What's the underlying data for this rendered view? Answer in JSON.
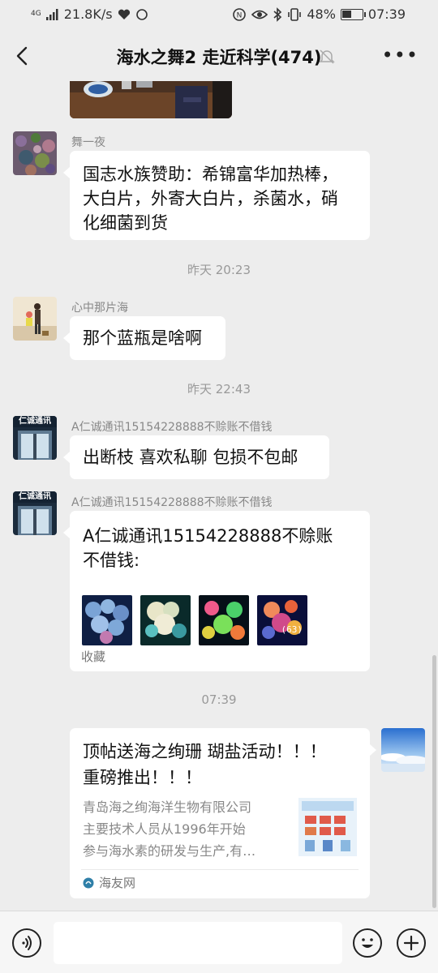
{
  "status": {
    "network": "4G",
    "speed": "21.8K/s",
    "battery": "48%",
    "battery_level": 0.48,
    "time": "07:39"
  },
  "header": {
    "title": "海水之舞2 走近科学(474)",
    "back_icon": "chevron-left-icon",
    "mute_icon": "bell-mute-icon",
    "more_icon": "more-icon"
  },
  "messages": [
    {
      "sender": "舞一夜",
      "text": [
        "国志水族赞助：希锦富华加热棒，",
        "大白片，外寄大白片，杀菌水，硝",
        "化细菌到货"
      ]
    },
    {
      "timestamp": "昨天 20:23"
    },
    {
      "sender": "心中那片海",
      "text": "那个蓝瓶是啥啊"
    },
    {
      "timestamp": "昨天 22:43"
    },
    {
      "sender": "A仁诚通讯15154228888不赊账不借钱",
      "avatar_sign": "仁诚通讯",
      "text": "出断枝 喜欢私聊 包损不包邮"
    },
    {
      "sender": "A仁诚通讯15154228888不赊账不借钱",
      "avatar_sign": "仁诚通讯",
      "card_title": [
        "A仁诚通讯15154228888不赊账",
        "不借钱:"
      ],
      "image_count": "(63)",
      "footer": "收藏"
    },
    {
      "timestamp": "07:39"
    },
    {
      "self": true,
      "link_title": [
        "顶帖送海之绚珊 瑚盐活动！！！",
        "重磅推出！！！"
      ],
      "link_desc": [
        "青岛海之绚海洋生物有限公司",
        "主要技术人员从1996年开始",
        "参与海水素的研发与生产,有…"
      ],
      "source": "海友网"
    }
  ],
  "input_bar": {
    "voice_icon": "voice-icon",
    "emoji_icon": "emoji-icon",
    "add_icon": "plus-icon"
  }
}
